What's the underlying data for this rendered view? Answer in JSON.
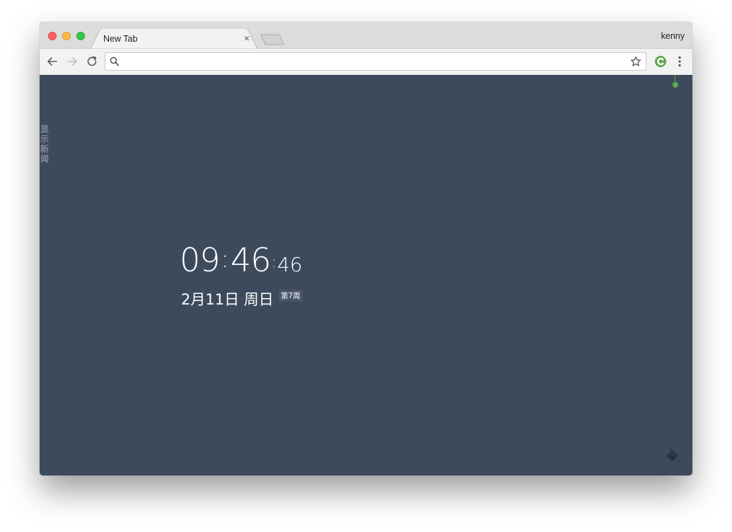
{
  "browser": {
    "tab_title": "New Tab",
    "tab_close": "×",
    "profile_name": "kenny",
    "accent_green": "#5fa84d"
  },
  "toolbar": {
    "omnibox_value": "",
    "omnibox_placeholder": ""
  },
  "newtab": {
    "news_toggle": [
      "显",
      "示",
      "新",
      "闻"
    ],
    "clock": {
      "hours": "09",
      "minutes": "46",
      "seconds": "46",
      "separator": ":"
    },
    "date_text": "2月11日 周日",
    "week_badge": "第7周",
    "background_color": "#3d4a5c"
  }
}
